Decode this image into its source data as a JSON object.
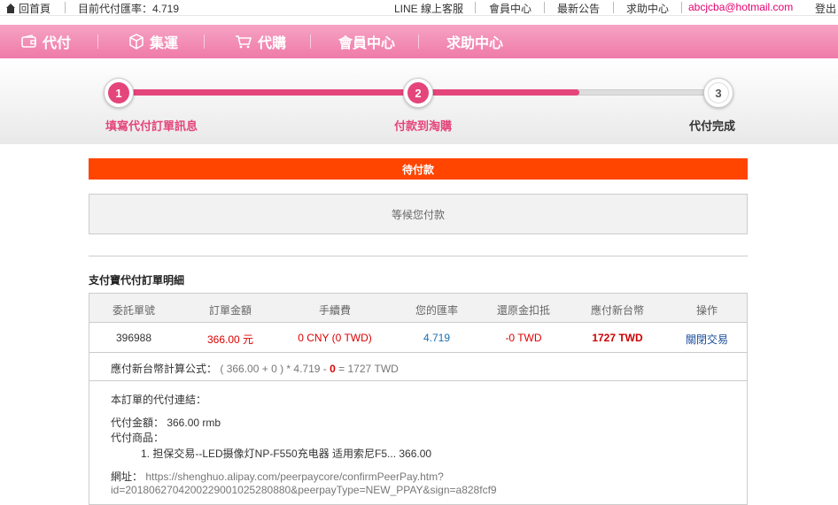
{
  "topbar": {
    "home_label": "回首頁",
    "rate_label": "目前代付匯率：4.719",
    "line_label": "LINE 線上客服",
    "member_label": "會員中心",
    "news_label": "最新公告",
    "help_label": "求助中心",
    "email": "abcjcba@hotmail.com",
    "logout_label": "登出"
  },
  "nav": {
    "items": [
      {
        "label": "代付",
        "icon": "wallet-icon"
      },
      {
        "label": "集運",
        "icon": "box-icon"
      },
      {
        "label": "代購",
        "icon": "cart-icon"
      },
      {
        "label": "會員中心"
      },
      {
        "label": "求助中心"
      }
    ]
  },
  "steps": [
    {
      "number": "1",
      "label": "填寫代付訂單訊息",
      "state": "done"
    },
    {
      "number": "2",
      "label": "付款到淘購",
      "state": "current"
    },
    {
      "number": "3",
      "label": "代付完成",
      "state": "todo"
    }
  ],
  "colors": {
    "accent": "#e4457a",
    "status": "#ff4500",
    "nav": "#ef7aa8"
  },
  "status": {
    "label": "待付款",
    "message": "等候您付款"
  },
  "detail": {
    "title": "支付寶代付訂單明細",
    "headers": [
      "委託單號",
      "訂單金額",
      "手續費",
      "您的匯率",
      "還原金扣抵",
      "應付新台幣",
      "操作"
    ],
    "row": {
      "order_no": "396988",
      "amount": "366.00 元",
      "fee": "0 CNY (0 TWD)",
      "rate": "4.719",
      "deduction": "-0 TWD",
      "payable": "1727 TWD",
      "action": "關閉交易"
    },
    "formula": {
      "prefix": "應付新台幣計算公式：",
      "part1": "( 366.00 + 0 ) * 4.719 -",
      "deduct": "0",
      "part2": "= 1727 TWD"
    },
    "links_title": "本訂單的代付連結：",
    "pay_amount": "代付金額： 366.00 rmb",
    "goods_label": "代付商品：",
    "goods_item": "1. 担保交易--LED摄像灯NP-F550充电器 适用索尼F5... 366.00",
    "url_label": "網址：",
    "url_line1": "https://shenghuo.alipay.com/peerpaycore/confirmPeerPay.htm?",
    "url_line2": "id=2018062704200229001025280880&peerpayType=NEW_PPAY&sign=a828fcf9"
  }
}
